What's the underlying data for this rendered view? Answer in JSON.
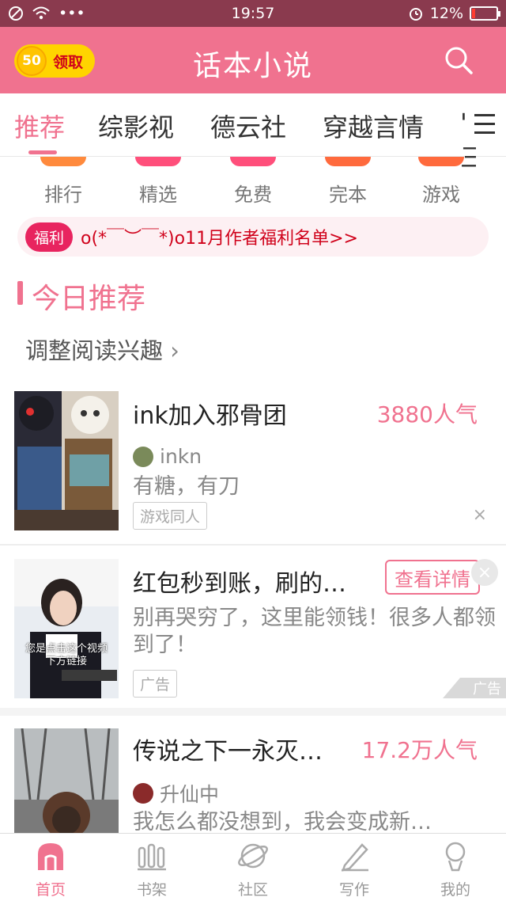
{
  "status": {
    "time": "19:57",
    "battery": "12%",
    "battery_level": 0.12,
    "dots": "•••"
  },
  "header": {
    "coin_value": "50",
    "coin_label": "领取",
    "title": "话本小说"
  },
  "tabs": [
    {
      "label": "推荐",
      "active": true
    },
    {
      "label": "综影视"
    },
    {
      "label": "德云社"
    },
    {
      "label": "穿越言情"
    },
    {
      "label": "' 三"
    }
  ],
  "categories": [
    {
      "label": "排行",
      "color": "#ff8a3d"
    },
    {
      "label": "精选",
      "color": "#ff4f7b"
    },
    {
      "label": "免费",
      "color": "#ff4f7b"
    },
    {
      "label": "完本",
      "color": "#ff6a3d"
    },
    {
      "label": "游戏",
      "color": "#ff6a3d"
    }
  ],
  "notice": {
    "tag": "福利",
    "text": "o(*￣︶￣*)o11月作者福利名单>>"
  },
  "section": {
    "title": "今日推荐",
    "subtitle": "调整阅读兴趣",
    "subtitle_arrow": "›"
  },
  "items": [
    {
      "title": "ink加入邪骨团",
      "popularity": "3880人气",
      "author": "inkn",
      "desc": "有糖，有刀",
      "tag": "游戏同人",
      "close": "×"
    },
    {
      "title": "红包秒到账，刷的…",
      "button": "查看详情",
      "desc": "别再哭穷了，这里能领钱！很多人都领到了！",
      "tag": "广告",
      "ad_mark": "广告",
      "close": "×",
      "thumb_caption": "您是点击这个视频\n下方链接"
    },
    {
      "title": "传说之下一永灭…",
      "popularity": "17.2万人气",
      "author": "升仙中",
      "desc": "我怎么都没想到，我会变成新…"
    }
  ],
  "bottom_nav": [
    {
      "label": "首页",
      "active": true,
      "icon": "home-icon"
    },
    {
      "label": "书架",
      "icon": "bookshelf-icon"
    },
    {
      "label": "社区",
      "icon": "planet-icon"
    },
    {
      "label": "写作",
      "icon": "pen-icon"
    },
    {
      "label": "我的",
      "icon": "person-icon"
    }
  ],
  "colors": {
    "brand": "#f0728f",
    "status_bar": "#8a3a4e",
    "warning": "#d0021b"
  }
}
